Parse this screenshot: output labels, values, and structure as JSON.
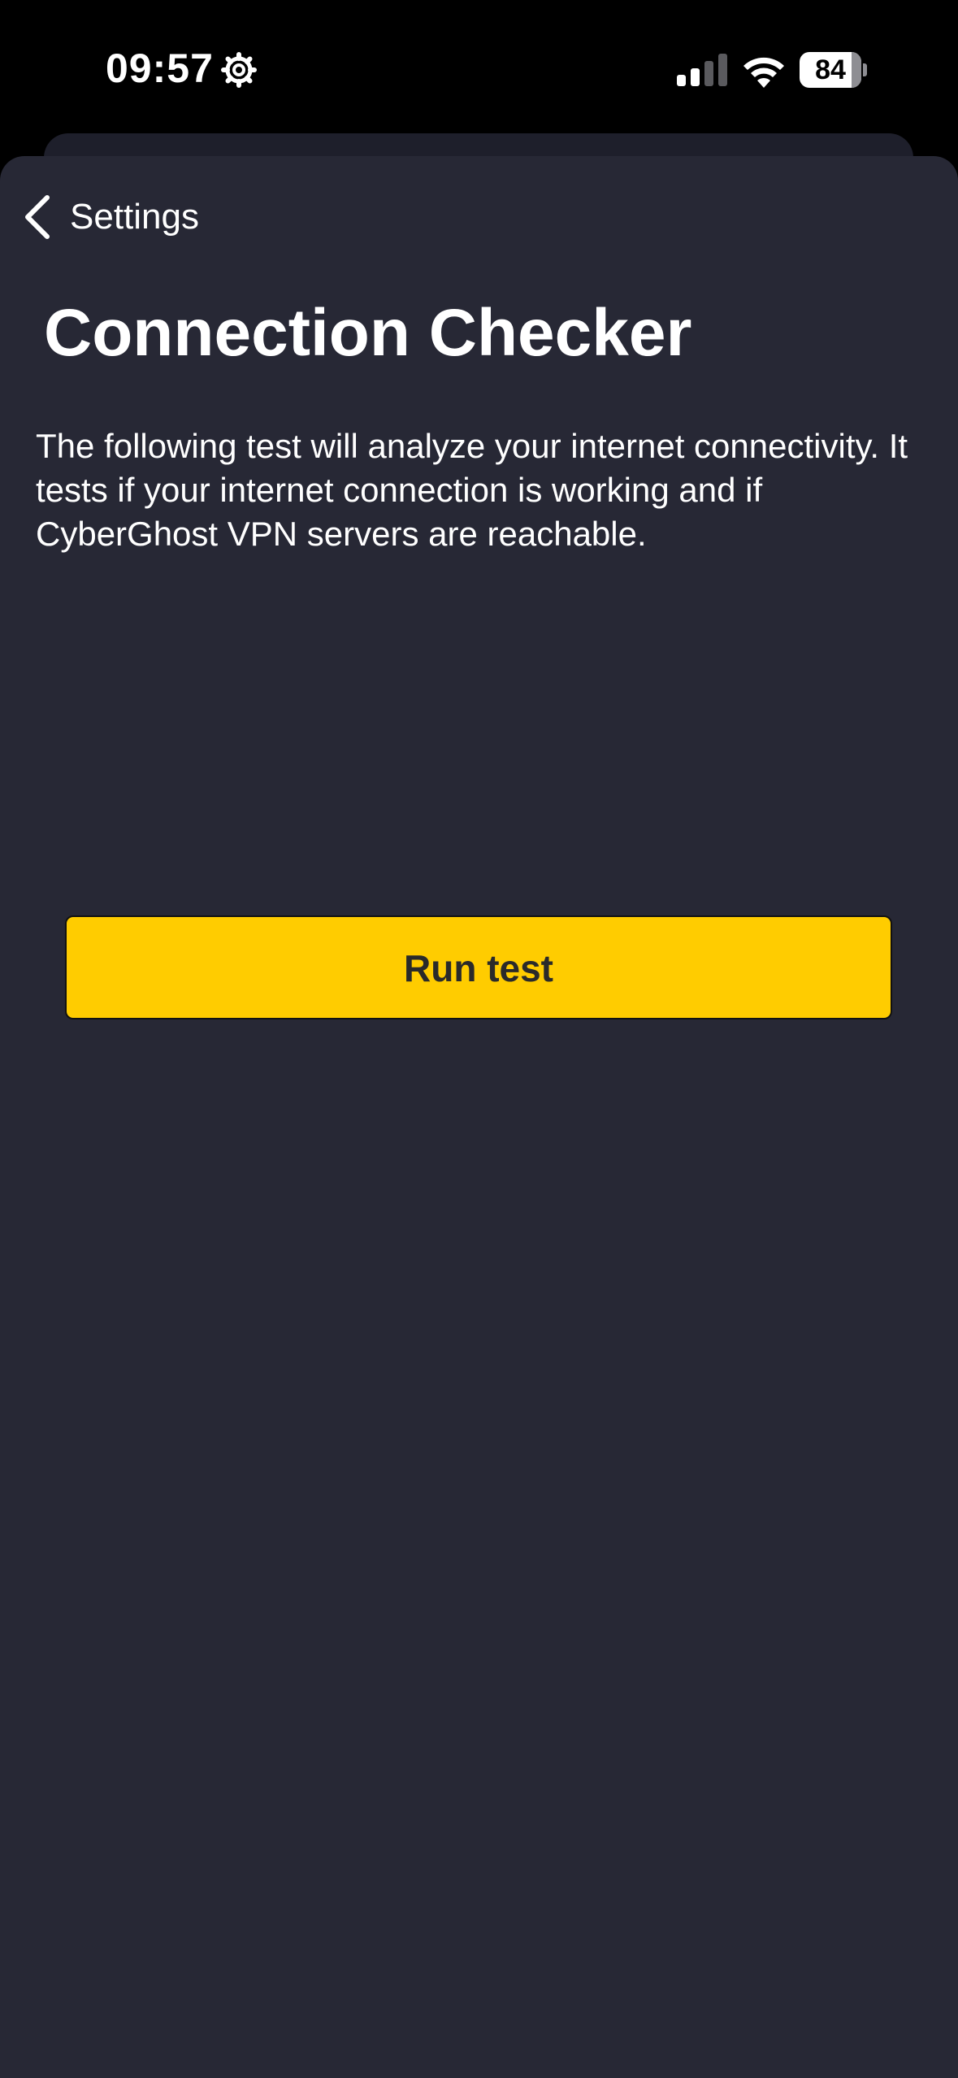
{
  "status_bar": {
    "time": "09:57",
    "battery_level": "84",
    "battery_percent": 84,
    "icons": [
      "gear-icon",
      "cellular-signal-icon",
      "wifi-icon",
      "battery-icon"
    ]
  },
  "nav": {
    "back_label": "Settings",
    "back_icon": "chevron-left-icon"
  },
  "page": {
    "title": "Connection Checker",
    "description": "The following test will analyze your internet connectivity. It tests if your internet connection is working and if CyberGhost VPN servers are reachable."
  },
  "actions": {
    "run_test_label": "Run test"
  },
  "colors": {
    "background": "#272835",
    "accent": "#ffcc00",
    "text": "#ffffff"
  }
}
